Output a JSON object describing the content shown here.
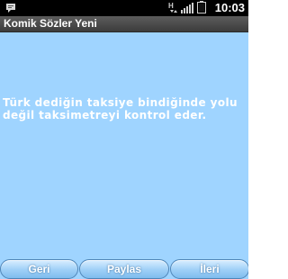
{
  "status_bar": {
    "time": "10:03",
    "network_letter": "H",
    "icons": [
      "notification-icon",
      "data-arrows-icon",
      "signal-icon",
      "battery-icon"
    ]
  },
  "app": {
    "title": "Komik Sözler Yeni"
  },
  "quote": {
    "text": "Türk dediğin taksiye bindiğinde yolu\ndeğil taksimetreyi kontrol eder."
  },
  "buttons": {
    "back": "Geri",
    "share": "Paylas",
    "next": "İleri"
  },
  "colors": {
    "background": "#9fd4ff",
    "title_bar": "#4a4a4a",
    "text": "#ffffff"
  }
}
